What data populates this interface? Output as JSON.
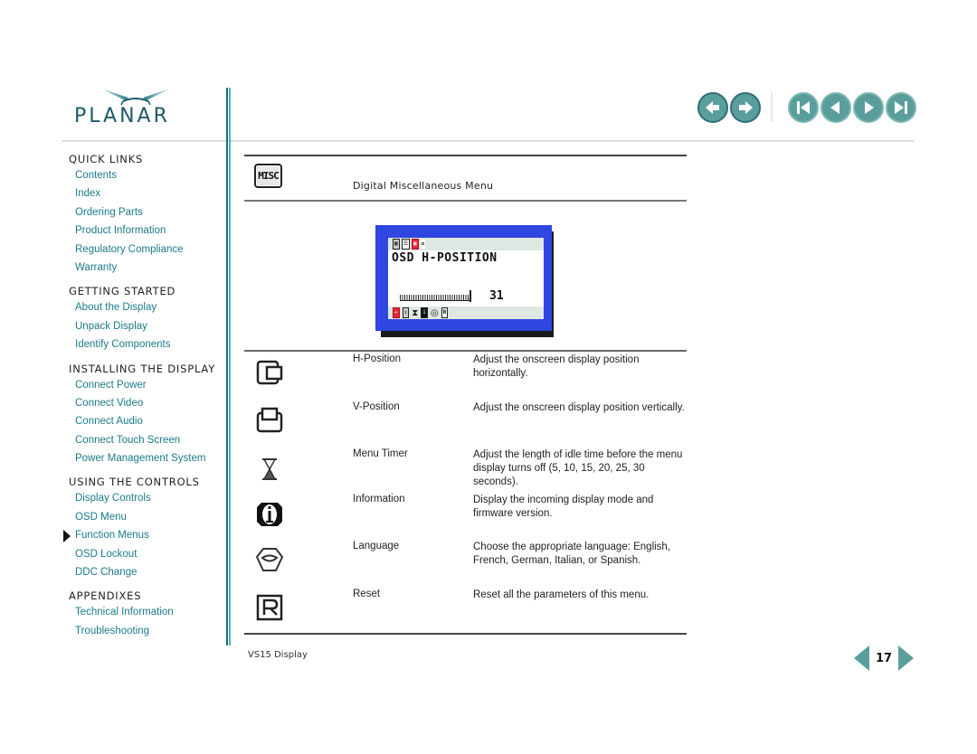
{
  "header": {
    "logo_text": "PLANAR",
    "nav_buttons": [
      "back",
      "forward",
      "first-page",
      "previous-page",
      "next-page",
      "last-page"
    ]
  },
  "sidebar": {
    "sections": [
      {
        "title": "QUICK LINKS",
        "links": [
          "Contents",
          "Index",
          "Ordering Parts",
          "Product Information",
          "Regulatory Compliance",
          "Warranty"
        ]
      },
      {
        "title": "GETTING STARTED",
        "links": [
          "About the Display",
          "Unpack Display",
          "Identify Components"
        ]
      },
      {
        "title": "INSTALLING THE DISPLAY",
        "links": [
          "Connect Power",
          "Connect Video",
          "Connect Audio",
          "Connect Touch Screen",
          "Power Management System"
        ]
      },
      {
        "title": "USING THE CONTROLS",
        "links": [
          "Display Controls",
          "OSD Menu",
          "Function Menus",
          "OSD Lockout",
          "DDC Change"
        ]
      },
      {
        "title": "APPENDIXES",
        "links": [
          "Technical Information",
          "Troubleshooting"
        ]
      }
    ],
    "active_link": "Function Menus"
  },
  "main": {
    "menu_icon_label": "MISC",
    "menu_title": "Digital Miscellaneous Menu",
    "osd": {
      "title": "OSD H-POSITION",
      "value": "31",
      "slider_fraction": 1.0,
      "top_chips": [
        "BRGT",
        "ADJ",
        "OSD",
        "COLOR"
      ],
      "bottom_chips": [
        "H",
        "V",
        "TIMER",
        "INFO",
        "LANG",
        "R"
      ],
      "colors": {
        "frame": "#2f47e0",
        "bar": "#dfe7e2",
        "highlight": "#e8253a"
      }
    },
    "functions": [
      {
        "icon": "h-position-icon",
        "name": "H-Position",
        "desc": "Adjust the onscreen display position horizontally."
      },
      {
        "icon": "v-position-icon",
        "name": "V-Position",
        "desc": "Adjust the onscreen display position vertically."
      },
      {
        "icon": "hourglass-icon",
        "name": "Menu Timer",
        "desc": "Adjust the length of idle time before the menu display turns off (5, 10, 15, 20, 25, 30 seconds)."
      },
      {
        "icon": "information-icon",
        "name": "Information",
        "desc": "Display the incoming display mode and firmware version."
      },
      {
        "icon": "language-icon",
        "name": "Language",
        "desc": "Choose the appropriate language: English, French, German, Italian, or Spanish."
      },
      {
        "icon": "reset-icon",
        "name": "Reset",
        "desc": "Reset all the parameters of this menu."
      }
    ]
  },
  "footer": {
    "label": "VS15 Display",
    "page_number": "17"
  },
  "colors": {
    "accent": "#1a7a8a",
    "nav_button": "#5a9e9c",
    "divider_dark": "#1c6f79",
    "divider_light": "#4fb3b5"
  }
}
